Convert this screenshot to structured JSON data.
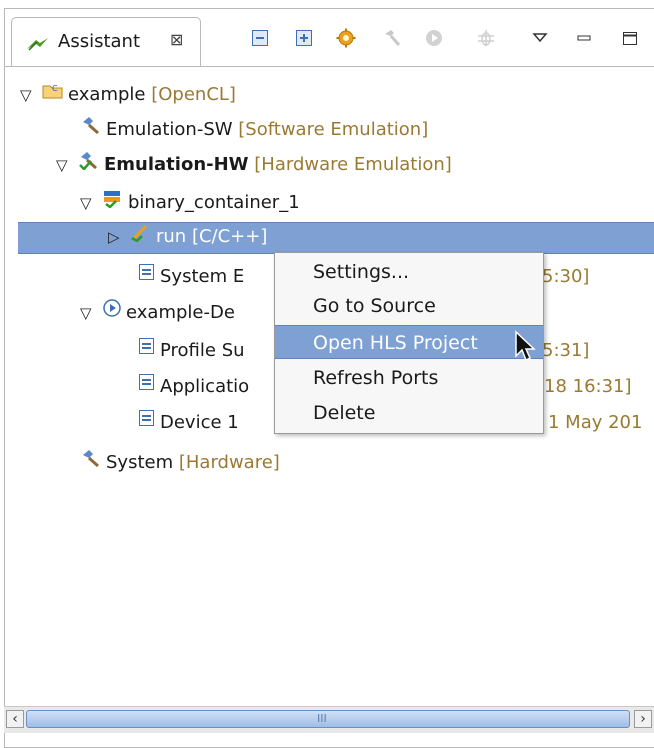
{
  "view": {
    "tab_label": "Assistant",
    "tab_close_glyph": "⊠",
    "toolbar_icons": [
      "collapse-all-icon",
      "expand-all-icon",
      "gear-icon",
      "build-hammer-icon",
      "run-icon",
      "debug-icon",
      "view-menu-icon",
      "minimize-icon",
      "maximize-icon"
    ]
  },
  "tree": [
    {
      "name": "example",
      "decoration": "[OpenCL]",
      "expanded": true
    },
    {
      "name": "Emulation-SW",
      "decoration": "[Software Emulation]"
    },
    {
      "name": "Emulation-HW",
      "decoration": "[Hardware Emulation]",
      "expanded": true,
      "bold": true
    },
    {
      "name": "binary_container_1",
      "decoration": "",
      "expanded": true
    },
    {
      "name": "run",
      "decoration": "[C/C++]",
      "collapsed": true,
      "selected": true
    },
    {
      "name": "System E",
      "decoration": "5:30]"
    },
    {
      "name": "example-De",
      "decoration": "",
      "expanded": true
    },
    {
      "name": "Profile Su",
      "decoration": "5:31]"
    },
    {
      "name": "Applicatio",
      "decoration": "18 16:31]"
    },
    {
      "name": "Device 1",
      "decoration": "1 May 201"
    },
    {
      "name": "System",
      "decoration": "[Hardware]"
    }
  ],
  "context_menu": {
    "items": [
      "Settings...",
      "Go to Source",
      "Open HLS Project",
      "Refresh Ports",
      "Delete"
    ],
    "highlighted_index": 2
  },
  "scrollbar": {
    "grip": "III",
    "left_arrow": "‹",
    "right_arrow": "›"
  },
  "colors": {
    "selection": "#7ea0d2",
    "decoration_text": "#9a7a33",
    "border": "#b8b8b8"
  }
}
